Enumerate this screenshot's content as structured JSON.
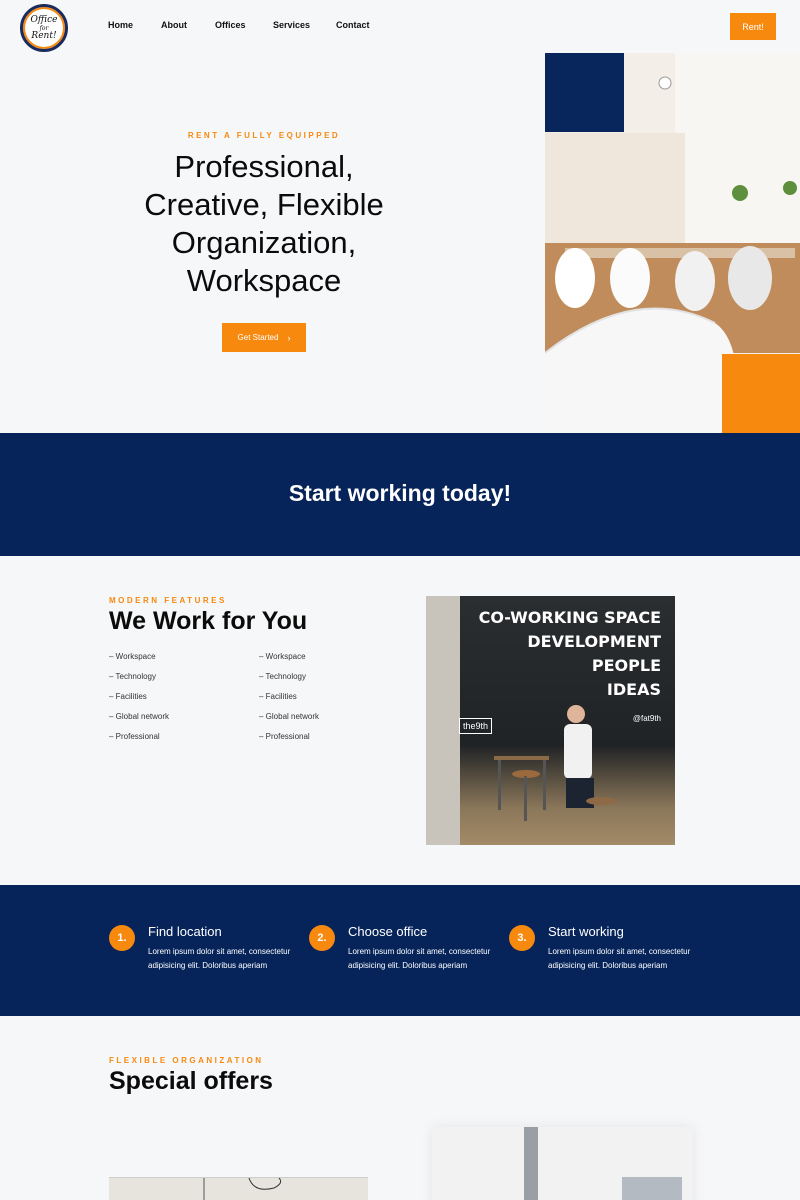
{
  "header": {
    "logo_text_1": "Office",
    "logo_text_2": "for",
    "logo_text_3": "Rent!",
    "nav": [
      "Home",
      "About",
      "Offices",
      "Services",
      "Contact"
    ],
    "cta_label": "Rent!"
  },
  "colors": {
    "accent": "#f7890f",
    "navy": "#06245a"
  },
  "hero": {
    "kicker": "RENT A FULLY EQUIPPED",
    "title_lines": [
      "Professional,",
      "Creative, Flexible",
      "Organization,",
      "Workspace"
    ],
    "button_label": "Get Started",
    "button_icon": "chevron-right-icon"
  },
  "band": {
    "title": "Start working today!"
  },
  "features": {
    "kicker": "MODERN FEATURES",
    "title": "We Work for You",
    "list_a": [
      "– Workspace",
      "– Technology",
      "– Facilities",
      "– Global network",
      "– Professional"
    ],
    "list_b": [
      "– Workspace",
      "– Technology",
      "– Facilities",
      "– Global network",
      "– Professional"
    ],
    "image_sign_lines": [
      "CO-WORKING SPACE",
      "DEVELOPMENT",
      "PEOPLE",
      "IDEAS"
    ],
    "image_handle": "@fat9th",
    "image_logo": "the9th"
  },
  "steps": [
    {
      "num": "1.",
      "title": "Find location",
      "desc": "Lorem ipsum dolor sit amet, consectetur adipisicing elit. Doloribus aperiam"
    },
    {
      "num": "2.",
      "title": "Choose office",
      "desc": "Lorem ipsum dolor sit amet, consectetur adipisicing elit. Doloribus aperiam"
    },
    {
      "num": "3.",
      "title": "Start working",
      "desc": "Lorem ipsum dolor sit amet, consectetur adipisicing elit. Doloribus aperiam"
    }
  ],
  "offers": {
    "kicker": "FLEXIBLE ORGANIZATION",
    "title": "Special offers"
  }
}
